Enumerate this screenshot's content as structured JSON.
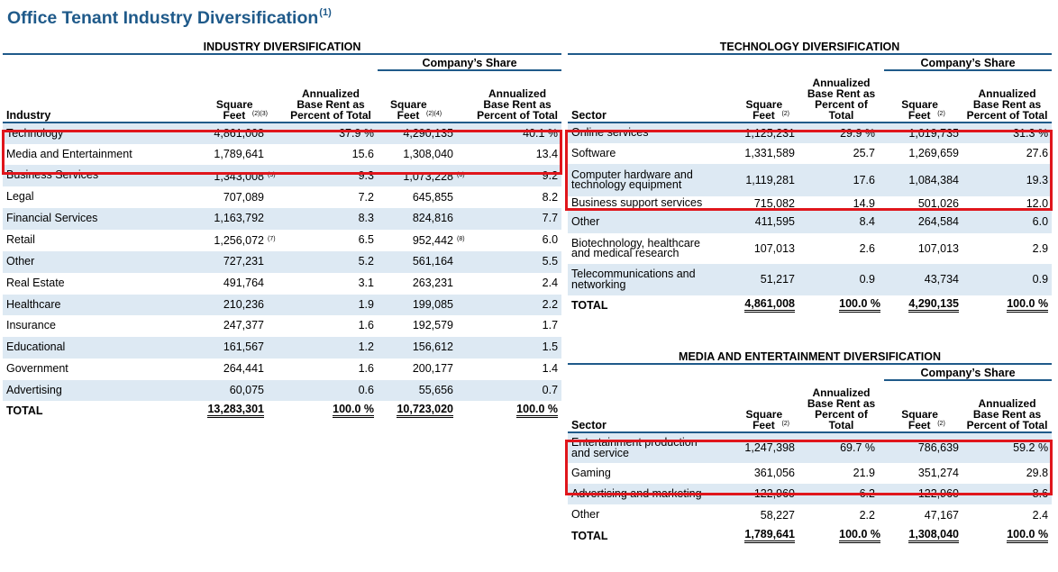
{
  "title": "Office Tenant Industry Diversification",
  "title_note": "(1)",
  "industry": {
    "band": "INDUSTRY DIVERSIFICATION",
    "share_label": "Company’s Share",
    "headers": {
      "label": "Industry",
      "sqft": "Square Feet",
      "sqft_note": "(2)(3)",
      "pct": "Annualized Base Rent as Percent of Total",
      "share_sqft": "Square Feet",
      "share_sqft_note": "(2)(4)",
      "share_pct": "Annualized Base Rent as Percent of Total"
    },
    "rows": [
      {
        "label": "Technology",
        "sqft": "4,861,008",
        "pct": "37.9 %",
        "share_sqft": "4,290,135",
        "share_pct": "40.1 %",
        "n1": "",
        "n2": ""
      },
      {
        "label": "Media and Entertainment",
        "sqft": "1,789,641",
        "pct": "15.6",
        "share_sqft": "1,308,040",
        "share_pct": "13.4",
        "n1": "",
        "n2": ""
      },
      {
        "label": "Business Services",
        "sqft": "1,343,008",
        "pct": "9.3",
        "share_sqft": "1,073,228",
        "share_pct": "9.2",
        "n1": "(5)",
        "n2": "(6)"
      },
      {
        "label": "Legal",
        "sqft": "707,089",
        "pct": "7.2",
        "share_sqft": "645,855",
        "share_pct": "8.2",
        "n1": "",
        "n2": ""
      },
      {
        "label": "Financial Services",
        "sqft": "1,163,792",
        "pct": "8.3",
        "share_sqft": "824,816",
        "share_pct": "7.7",
        "n1": "",
        "n2": ""
      },
      {
        "label": "Retail",
        "sqft": "1,256,072",
        "pct": "6.5",
        "share_sqft": "952,442",
        "share_pct": "6.0",
        "n1": "(7)",
        "n2": "(8)"
      },
      {
        "label": "Other",
        "sqft": "727,231",
        "pct": "5.2",
        "share_sqft": "561,164",
        "share_pct": "5.5",
        "n1": "",
        "n2": ""
      },
      {
        "label": "Real Estate",
        "sqft": "491,764",
        "pct": "3.1",
        "share_sqft": "263,231",
        "share_pct": "2.4",
        "n1": "",
        "n2": ""
      },
      {
        "label": "Healthcare",
        "sqft": "210,236",
        "pct": "1.9",
        "share_sqft": "199,085",
        "share_pct": "2.2",
        "n1": "",
        "n2": ""
      },
      {
        "label": "Insurance",
        "sqft": "247,377",
        "pct": "1.6",
        "share_sqft": "192,579",
        "share_pct": "1.7",
        "n1": "",
        "n2": ""
      },
      {
        "label": "Educational",
        "sqft": "161,567",
        "pct": "1.2",
        "share_sqft": "156,612",
        "share_pct": "1.5",
        "n1": "",
        "n2": ""
      },
      {
        "label": "Government",
        "sqft": "264,441",
        "pct": "1.6",
        "share_sqft": "200,177",
        "share_pct": "1.4",
        "n1": "",
        "n2": ""
      },
      {
        "label": "Advertising",
        "sqft": "60,075",
        "pct": "0.6",
        "share_sqft": "55,656",
        "share_pct": "0.7",
        "n1": "",
        "n2": ""
      }
    ],
    "total": {
      "label": "TOTAL",
      "sqft": "13,283,301",
      "pct": "100.0 %",
      "share_sqft": "10,723,020",
      "share_pct": "100.0 %"
    }
  },
  "technology": {
    "band": "TECHNOLOGY DIVERSIFICATION",
    "share_label": "Company’s Share",
    "headers": {
      "label": "Sector",
      "sqft": "Square Feet",
      "sqft_note": "(2)",
      "pct": "Annualized Base Rent as Percent of Total",
      "share_sqft": "Square Feet",
      "share_sqft_note": "(2)",
      "share_pct": "Annualized Base Rent as Percent of Total"
    },
    "rows": [
      {
        "label": "Online services",
        "sqft": "1,125,231",
        "pct": "29.9 %",
        "share_sqft": "1,019,735",
        "share_pct": "31.3 %"
      },
      {
        "label": "Software",
        "sqft": "1,331,589",
        "pct": "25.7",
        "share_sqft": "1,269,659",
        "share_pct": "27.6"
      },
      {
        "label": "Computer hardware and technology equipment",
        "sqft": "1,119,281",
        "pct": "17.6",
        "share_sqft": "1,084,384",
        "share_pct": "19.3"
      },
      {
        "label": "Business support services",
        "sqft": "715,082",
        "pct": "14.9",
        "share_sqft": "501,026",
        "share_pct": "12.0"
      },
      {
        "label": "Other",
        "sqft": "411,595",
        "pct": "8.4",
        "share_sqft": "264,584",
        "share_pct": "6.0"
      },
      {
        "label": "Biotechnology, healthcare and medical research",
        "sqft": "107,013",
        "pct": "2.6",
        "share_sqft": "107,013",
        "share_pct": "2.9"
      },
      {
        "label": "Telecommunications and networking",
        "sqft": "51,217",
        "pct": "0.9",
        "share_sqft": "43,734",
        "share_pct": "0.9"
      }
    ],
    "total": {
      "label": "TOTAL",
      "sqft": "4,861,008",
      "pct": "100.0 %",
      "share_sqft": "4,290,135",
      "share_pct": "100.0 %"
    }
  },
  "media": {
    "band": "MEDIA AND ENTERTAINMENT DIVERSIFICATION",
    "share_label": "Company’s Share",
    "headers": {
      "label": "Sector",
      "sqft": "Square Feet",
      "sqft_note": "(2)",
      "pct": "Annualized Base Rent as Percent of Total",
      "share_sqft": "Square Feet",
      "share_sqft_note": "(2)",
      "share_pct": "Annualized Base Rent as Percent of Total"
    },
    "rows": [
      {
        "label": "Entertainment production and service",
        "sqft": "1,247,398",
        "pct": "69.7 %",
        "share_sqft": "786,639",
        "share_pct": "59.2 %"
      },
      {
        "label": "Gaming",
        "sqft": "361,056",
        "pct": "21.9",
        "share_sqft": "351,274",
        "share_pct": "29.8"
      },
      {
        "label": "Advertising and marketing",
        "sqft": "122,960",
        "pct": "6.2",
        "share_sqft": "122,960",
        "share_pct": "8.6"
      },
      {
        "label": "Other",
        "sqft": "58,227",
        "pct": "2.2",
        "share_sqft": "47,167",
        "share_pct": "2.4"
      }
    ],
    "total": {
      "label": "TOTAL",
      "sqft": "1,789,641",
      "pct": "100.0 %",
      "share_sqft": "1,308,040",
      "share_pct": "100.0 %"
    }
  },
  "highlight_color": "#e0161c",
  "accent_color": "#1f5a8a",
  "row_shade_color": "#dde9f3"
}
